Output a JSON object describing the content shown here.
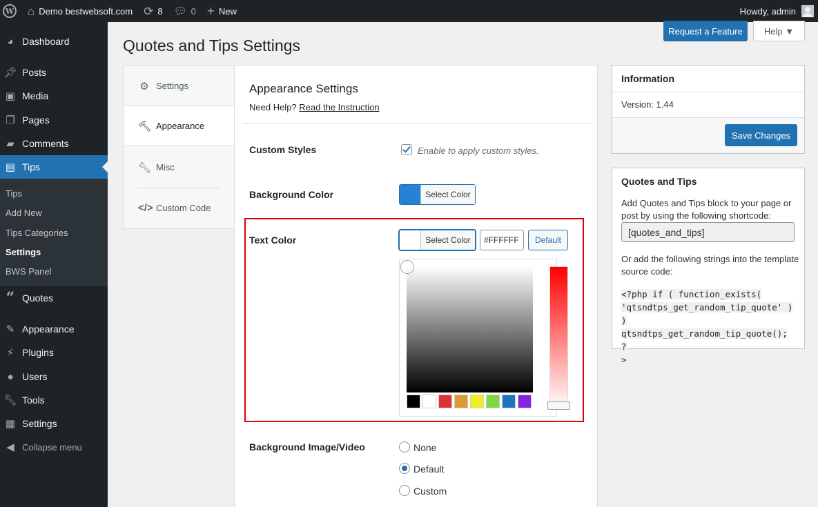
{
  "adminbar": {
    "site_name": "Demo bestwebsoft.com",
    "updates_count": "8",
    "comments_count": "0",
    "new_label": "New",
    "greeting": "Howdy, admin"
  },
  "sidebar": {
    "items": [
      {
        "label": "Dashboard",
        "icon": "dashboard-icon"
      },
      {
        "label": "Posts",
        "icon": "pin-icon"
      },
      {
        "label": "Media",
        "icon": "media-icon"
      },
      {
        "label": "Pages",
        "icon": "pages-icon"
      },
      {
        "label": "Comments",
        "icon": "comment-icon"
      },
      {
        "label": "Tips",
        "icon": "tips-icon"
      },
      {
        "label": "Quotes",
        "icon": "quote-icon"
      },
      {
        "label": "Appearance",
        "icon": "brush-icon"
      },
      {
        "label": "Plugins",
        "icon": "plug-icon"
      },
      {
        "label": "Users",
        "icon": "user-icon"
      },
      {
        "label": "Tools",
        "icon": "wrench-icon"
      },
      {
        "label": "Settings",
        "icon": "settings-icon"
      }
    ],
    "submenu": [
      "Tips",
      "Add New",
      "Tips Categories",
      "Settings",
      "BWS Panel"
    ],
    "collapse_label": "Collapse menu"
  },
  "header": {
    "request_feature": "Request a Feature",
    "help": "Help ▼",
    "page_title": "Quotes and Tips Settings"
  },
  "tabs": [
    "Settings",
    "Appearance",
    "Misc",
    "Custom Code"
  ],
  "main": {
    "section_title": "Appearance Settings",
    "help_prefix": "Need Help?",
    "help_link": "Read the Instruction",
    "custom_styles_label": "Custom Styles",
    "custom_styles_desc": "Enable to apply custom styles.",
    "bg_color_label": "Background Color",
    "bg_color_swatch": "#2582d4",
    "select_color": "Select Color",
    "text_color_label": "Text Color",
    "text_color_value": "#FFFFFF",
    "default_label": "Default",
    "palette": [
      "#000000",
      "#ffffff",
      "#dd3333",
      "#dd9933",
      "#eeee22",
      "#81d742",
      "#1e73be",
      "#8224e3"
    ],
    "bg_image_label": "Background Image/Video",
    "radio_options": [
      "None",
      "Default",
      "Custom"
    ]
  },
  "info_box": {
    "title": "Information",
    "version": "Version: 1.44",
    "save": "Save Changes"
  },
  "shortcode_box": {
    "title": "Quotes and Tips",
    "text1": "Add Quotes and Tips block to your page or post by using the following shortcode:",
    "shortcode": "[quotes_and_tips]",
    "text2": "Or add the following strings into the template source code:",
    "code_lines": [
      "<?php if ( function_exists(",
      "'qtsndtps_get_random_tip_quote' ) )",
      "qtsndtps_get_random_tip_quote(); ?",
      ">"
    ]
  }
}
